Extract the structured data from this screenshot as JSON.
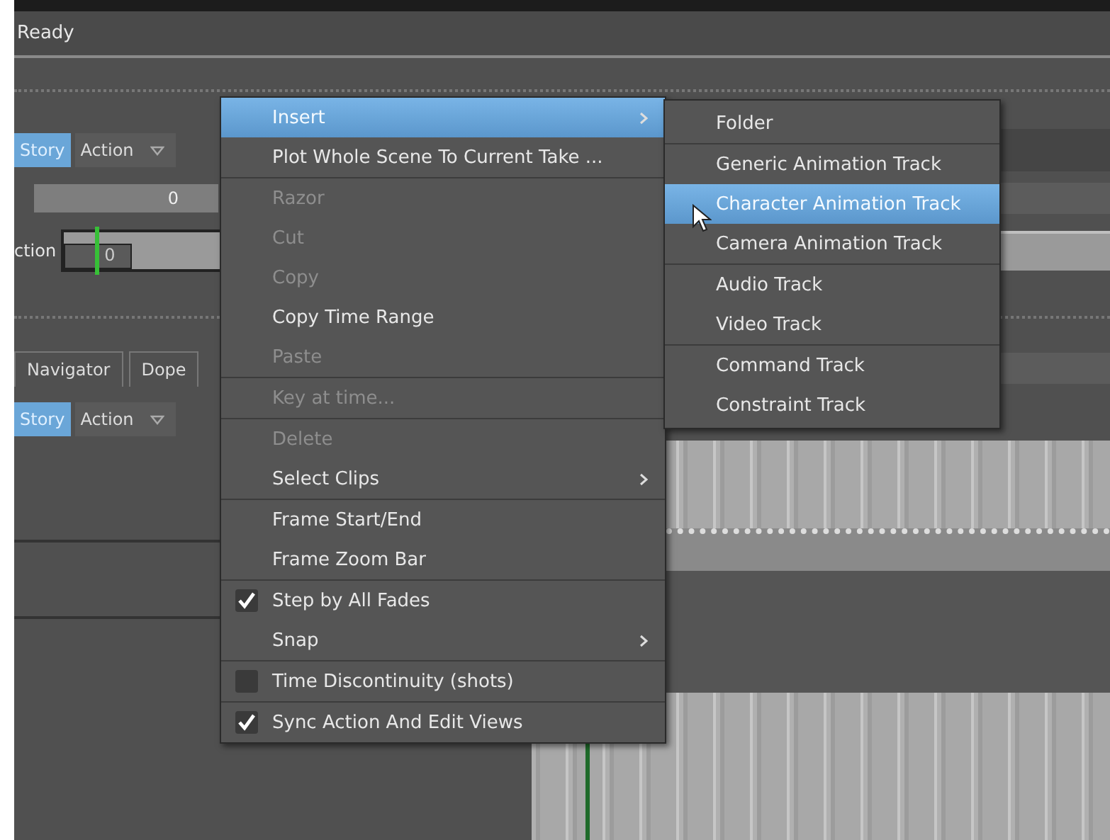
{
  "status": "Ready",
  "upper_panel": {
    "mode_button": {
      "label": "Story",
      "selected": true
    },
    "dropdown": {
      "value": "Action"
    },
    "field_value": "0",
    "row_label": "ction",
    "timeline_value": "0"
  },
  "lower_panel": {
    "tabs": [
      {
        "label": "Navigator",
        "selected": false
      },
      {
        "label": "Dope",
        "selected": false
      }
    ],
    "mode_button": {
      "label": "Story",
      "selected": true
    },
    "dropdown": {
      "value": "Action"
    }
  },
  "context_menu": {
    "groups": [
      [
        {
          "label": "Insert",
          "kind": "plain",
          "selected": true,
          "disabled": false,
          "has_submenu": true
        },
        {
          "label": "Plot Whole Scene To Current Take ...",
          "kind": "plain",
          "selected": false,
          "disabled": false,
          "has_submenu": false
        }
      ],
      [
        {
          "label": "Razor",
          "kind": "plain",
          "selected": false,
          "disabled": true,
          "has_submenu": false
        },
        {
          "label": "Cut",
          "kind": "plain",
          "selected": false,
          "disabled": true,
          "has_submenu": false
        },
        {
          "label": "Copy",
          "kind": "plain",
          "selected": false,
          "disabled": true,
          "has_submenu": false
        },
        {
          "label": "Copy Time Range",
          "kind": "plain",
          "selected": false,
          "disabled": false,
          "has_submenu": false
        },
        {
          "label": "Paste",
          "kind": "plain",
          "selected": false,
          "disabled": true,
          "has_submenu": false
        }
      ],
      [
        {
          "label": "Key at time...",
          "kind": "plain",
          "selected": false,
          "disabled": true,
          "has_submenu": false
        }
      ],
      [
        {
          "label": "Delete",
          "kind": "plain",
          "selected": false,
          "disabled": true,
          "has_submenu": false
        },
        {
          "label": "Select Clips",
          "kind": "plain",
          "selected": false,
          "disabled": false,
          "has_submenu": true
        }
      ],
      [
        {
          "label": "Frame Start/End",
          "kind": "plain",
          "selected": false,
          "disabled": false,
          "has_submenu": false
        },
        {
          "label": "Frame Zoom Bar",
          "kind": "plain",
          "selected": false,
          "disabled": false,
          "has_submenu": false
        }
      ],
      [
        {
          "label": "Step by All Fades",
          "kind": "check",
          "checked": true,
          "selected": false,
          "disabled": false,
          "has_submenu": false
        },
        {
          "label": "Snap",
          "kind": "plain",
          "selected": false,
          "disabled": false,
          "has_submenu": true
        }
      ],
      [
        {
          "label": "Time Discontinuity (shots)",
          "kind": "check",
          "checked": false,
          "selected": false,
          "disabled": false,
          "has_submenu": false
        }
      ],
      [
        {
          "label": "Sync Action And Edit Views",
          "kind": "check",
          "checked": true,
          "selected": false,
          "disabled": false,
          "has_submenu": false
        }
      ]
    ]
  },
  "submenu": {
    "groups": [
      [
        {
          "label": "Folder",
          "selected": false
        }
      ],
      [
        {
          "label": "Generic Animation Track",
          "selected": false
        },
        {
          "label": "Character Animation Track",
          "selected": true
        },
        {
          "label": "Camera Animation Track",
          "selected": false
        }
      ],
      [
        {
          "label": "Audio Track",
          "selected": false
        },
        {
          "label": "Video Track",
          "selected": false
        }
      ],
      [
        {
          "label": "Command Track",
          "selected": false
        },
        {
          "label": "Constraint Track",
          "selected": false
        }
      ]
    ]
  }
}
